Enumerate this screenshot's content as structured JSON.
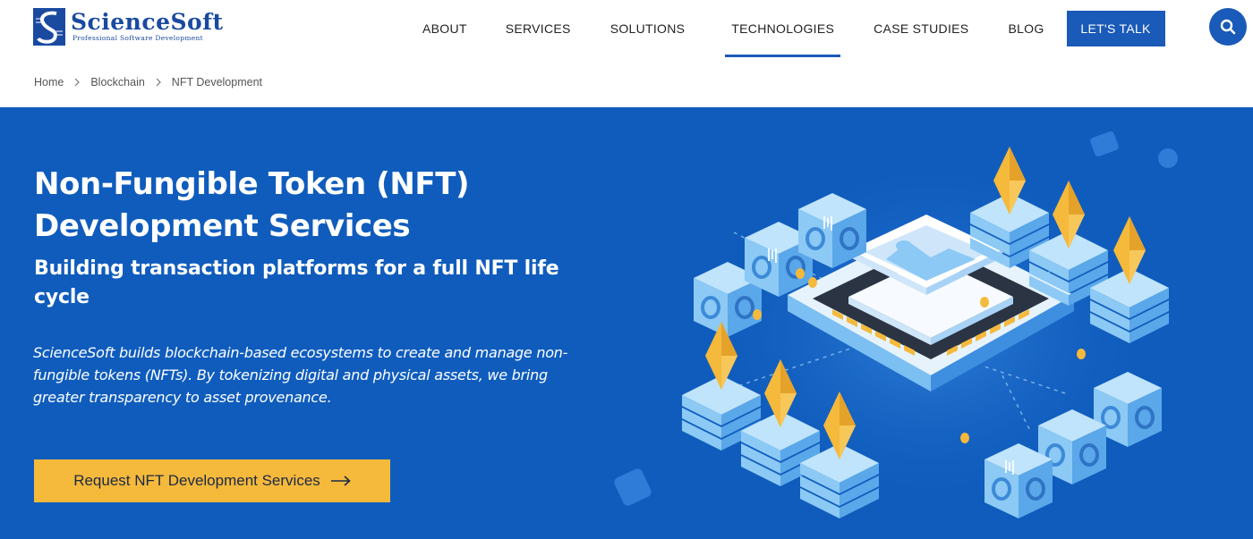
{
  "header": {
    "logo": {
      "name": "ScienceSoft",
      "tagline": "Professional Software Development"
    },
    "nav": [
      {
        "label": "ABOUT",
        "active": false
      },
      {
        "label": "SERVICES",
        "active": false
      },
      {
        "label": "SOLUTIONS",
        "active": false
      },
      {
        "label": "TECHNOLOGIES",
        "active": true
      },
      {
        "label": "CASE STUDIES",
        "active": false
      },
      {
        "label": "BLOG",
        "active": false
      }
    ],
    "cta_label": "LET'S TALK",
    "search_icon": "search-icon"
  },
  "breadcrumb": [
    "Home",
    "Blockchain",
    "NFT Development"
  ],
  "hero": {
    "title": "Non-Fungible Token (NFT) Development Services",
    "subtitle": "Building transaction platforms for a full NFT life cycle",
    "description": "ScienceSoft builds blockchain-based ecosystems to create and manage non-fungible tokens (NFTs). By tokenizing digital and physical assets, we bring greater transparency to asset provenance.",
    "cta_label": "Request NFT Development Services",
    "cta_icon": "arrow-right-icon"
  },
  "colors": {
    "brand_blue": "#1a5ab8",
    "hero_bg": "#0f5cbd",
    "cta_yellow": "#f5b93b",
    "token_gold": "#f5b93b"
  }
}
